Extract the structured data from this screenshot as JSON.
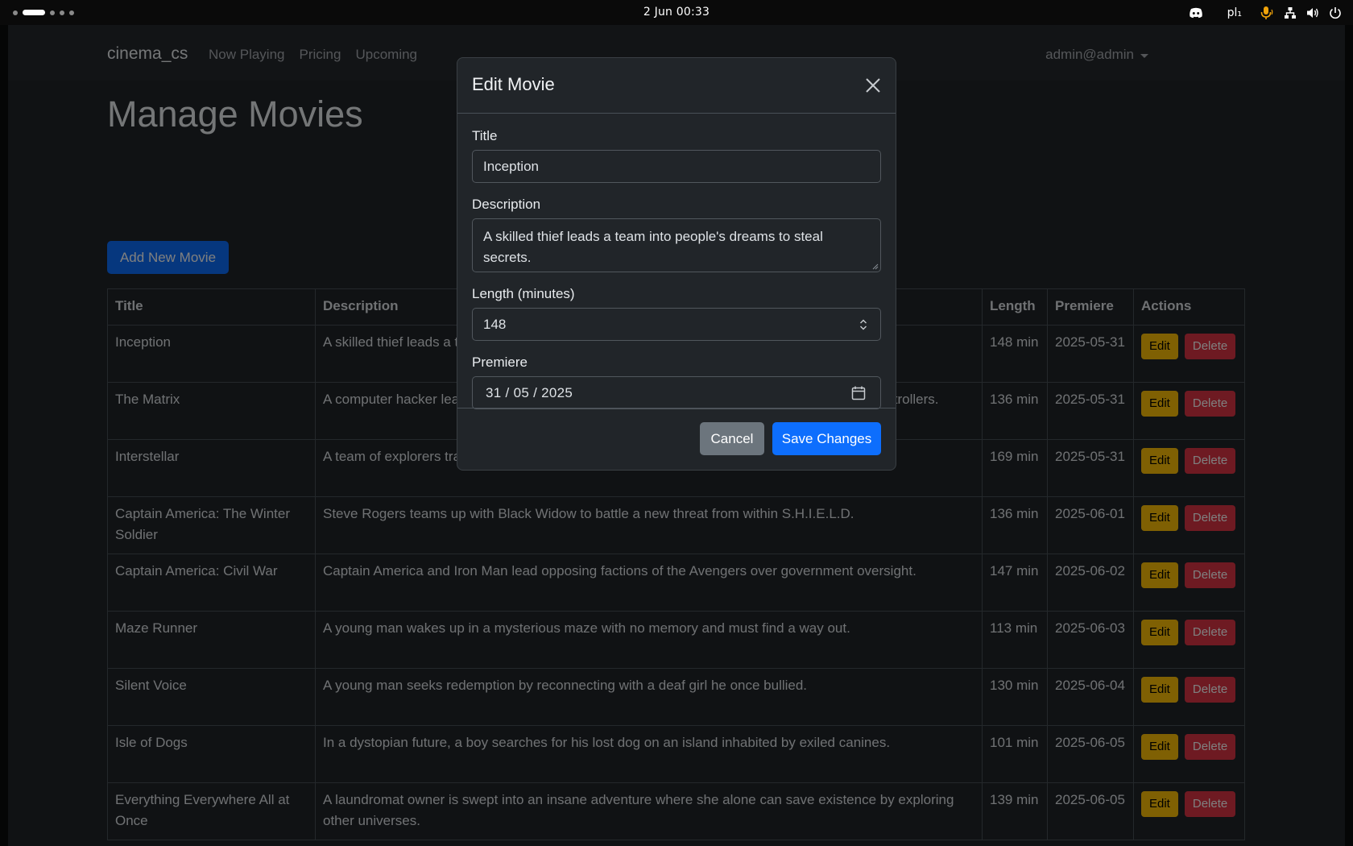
{
  "topbar": {
    "clock": "2 Jun  00:33",
    "keyboard_layout": "pl₁",
    "icons": [
      "discord-icon",
      "microphone-icon",
      "network-icon",
      "volume-icon",
      "power-icon"
    ]
  },
  "navbar": {
    "brand": "cinema_cs",
    "links": [
      "Now Playing",
      "Pricing",
      "Upcoming"
    ],
    "user": "admin@admin"
  },
  "page": {
    "title": "Manage Movies",
    "add_button": "Add New Movie"
  },
  "table": {
    "headers": [
      "Title",
      "Description",
      "Length",
      "Premiere",
      "Actions"
    ],
    "edit_label": "Edit",
    "delete_label": "Delete",
    "rows": [
      {
        "title": "Inception",
        "description": "A skilled thief leads a team into people's dreams to steal secrets.",
        "length": "148 min",
        "premiere": "2025-05-31"
      },
      {
        "title": "The Matrix",
        "description": "A computer hacker learns about the true nature of reality and his role in the war against its controllers.",
        "length": "136 min",
        "premiere": "2025-05-31"
      },
      {
        "title": "Interstellar",
        "description": "A team of explorers travel through a wormhole in space to ensure humanity's survival.",
        "length": "169 min",
        "premiere": "2025-05-31"
      },
      {
        "title": "Captain America: The Winter Soldier",
        "description": "Steve Rogers teams up with Black Widow to battle a new threat from within S.H.I.E.L.D.",
        "length": "136 min",
        "premiere": "2025-06-01"
      },
      {
        "title": "Captain America: Civil War",
        "description": "Captain America and Iron Man lead opposing factions of the Avengers over government oversight.",
        "length": "147 min",
        "premiere": "2025-06-02"
      },
      {
        "title": "Maze Runner",
        "description": "A young man wakes up in a mysterious maze with no memory and must find a way out.",
        "length": "113 min",
        "premiere": "2025-06-03"
      },
      {
        "title": "Silent Voice",
        "description": "A young man seeks redemption by reconnecting with a deaf girl he once bullied.",
        "length": "130 min",
        "premiere": "2025-06-04"
      },
      {
        "title": "Isle of Dogs",
        "description": "In a dystopian future, a boy searches for his lost dog on an island inhabited by exiled canines.",
        "length": "101 min",
        "premiere": "2025-06-05"
      },
      {
        "title": "Everything Everywhere All at Once",
        "description": "A laundromat owner is swept into an insane adventure where she alone can save existence by exploring other universes.",
        "length": "139 min",
        "premiere": "2025-06-05"
      }
    ]
  },
  "modal": {
    "title": "Edit Movie",
    "fields": {
      "title_label": "Title",
      "title_value": "Inception",
      "description_label": "Description",
      "description_value": "A skilled thief leads a team into people's dreams to steal secrets.",
      "length_label": "Length (minutes)",
      "length_value": "148",
      "premiere_label": "Premiere",
      "premiere_value": "31 / 05 / 2025"
    },
    "cancel_label": "Cancel",
    "save_label": "Save Changes"
  },
  "colors": {
    "primary": "#0d6efd",
    "warning": "#ffc107",
    "danger": "#dc3545",
    "secondary": "#6c757d",
    "page_bg": "#212529"
  }
}
